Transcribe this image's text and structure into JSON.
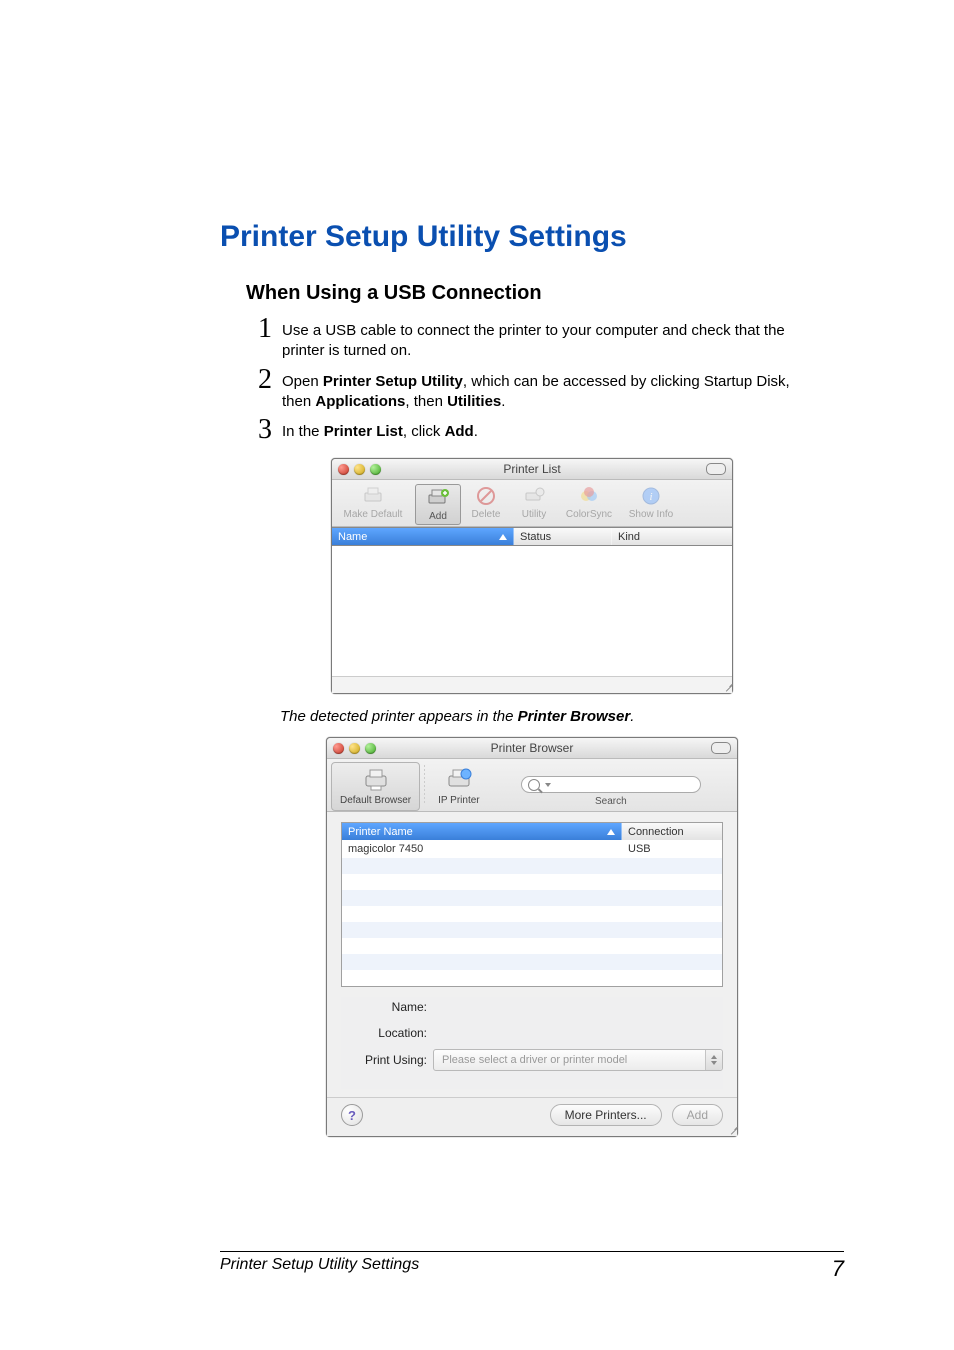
{
  "heading": "Printer Setup Utility Settings",
  "subheading": "When Using a USB Connection",
  "steps": {
    "n1": "1",
    "t1_a": "Use a USB cable to connect the printer to your computer and check that the printer is turned on.",
    "n2": "2",
    "t2_pre": "Open ",
    "t2_b1": "Printer Setup Utility",
    "t2_mid": ", which can be accessed by clicking Startup Disk, then ",
    "t2_b2": "Applications",
    "t2_mid2": ", then ",
    "t2_b3": "Utilities",
    "t2_end": ".",
    "n3": "3",
    "t3_pre": "In the ",
    "t3_b1": "Printer List",
    "t3_mid": ", click ",
    "t3_b2": "Add",
    "t3_end": "."
  },
  "caption_pre": "The detected printer appears in the ",
  "caption_b": "Printer Browser",
  "caption_end": ".",
  "printer_list": {
    "title": "Printer List",
    "toolbar": {
      "make_default": "Make Default",
      "add": "Add",
      "delete": "Delete",
      "utility": "Utility",
      "colorsync": "ColorSync",
      "show_info": "Show Info"
    },
    "columns": {
      "name": "Name",
      "status": "Status",
      "kind": "Kind"
    }
  },
  "printer_browser": {
    "title": "Printer Browser",
    "tabs": {
      "default": "Default Browser",
      "ip": "IP Printer",
      "search": "Search"
    },
    "columns": {
      "printer_name": "Printer Name",
      "connection": "Connection"
    },
    "rows": [
      {
        "name": "magicolor 7450",
        "connection": "USB"
      }
    ],
    "form": {
      "name_label": "Name:",
      "location_label": "Location:",
      "print_using_label": "Print Using:",
      "print_using_value": "Please select a driver or printer model"
    },
    "buttons": {
      "more": "More Printers...",
      "add": "Add"
    },
    "help": "?"
  },
  "footer": {
    "text": "Printer Setup Utility Settings",
    "page": "7"
  },
  "search_placeholder": "Q"
}
